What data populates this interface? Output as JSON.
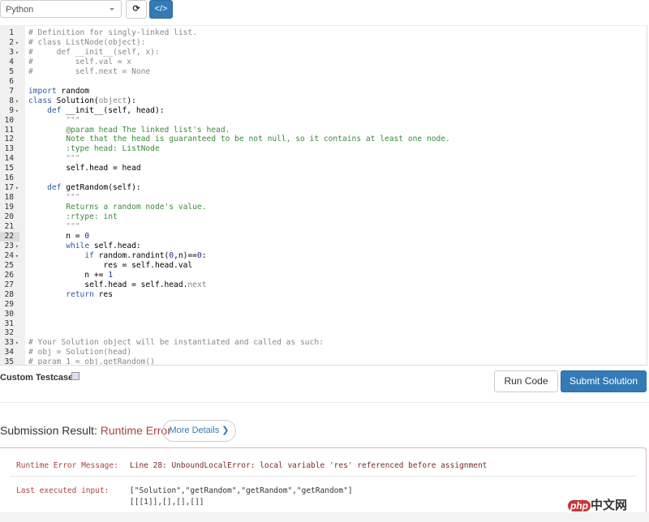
{
  "toolbar": {
    "language": "Python",
    "refresh_icon": "⟳",
    "code_icon": "</>"
  },
  "editor": {
    "active_line": 22,
    "lines": [
      [
        [
          "# Definition for singly-linked list.",
          "c"
        ]
      ],
      [
        [
          "# class ListNode(object):",
          "c"
        ]
      ],
      [
        [
          "#     def __init__(self, x):",
          "c"
        ]
      ],
      [
        [
          "#         self.val = x",
          "c"
        ]
      ],
      [
        [
          "#         self.next = None",
          "c"
        ]
      ],
      [],
      [
        [
          "import",
          "k"
        ],
        [
          " random",
          ""
        ]
      ],
      [
        [
          "class",
          "k"
        ],
        [
          " Solution(",
          ""
        ],
        [
          "object",
          "c"
        ],
        [
          "):",
          ""
        ]
      ],
      [
        [
          "    ",
          ""
        ],
        [
          "def",
          "k"
        ],
        [
          " __init__(self, head):",
          ""
        ]
      ],
      [
        [
          "        \"\"\"",
          "p"
        ]
      ],
      [
        [
          "        @param head The linked list's head.",
          "s"
        ]
      ],
      [
        [
          "        Note that the head is guaranteed to be not null, so it contains at least one node.",
          "s"
        ]
      ],
      [
        [
          "        :type head: ListNode",
          "s"
        ]
      ],
      [
        [
          "        \"\"\"",
          "p"
        ]
      ],
      [
        [
          "        self.head = head",
          ""
        ]
      ],
      [],
      [
        [
          "    ",
          ""
        ],
        [
          "def",
          "k"
        ],
        [
          " getRandom(self):",
          ""
        ]
      ],
      [
        [
          "        \"\"\"",
          "p"
        ]
      ],
      [
        [
          "        Returns a random node's value.",
          "s"
        ]
      ],
      [
        [
          "        :rtype: int",
          "s"
        ]
      ],
      [
        [
          "        \"\"\"",
          "p"
        ]
      ],
      [
        [
          "        n = ",
          ""
        ],
        [
          "0",
          "n"
        ]
      ],
      [
        [
          "        ",
          ""
        ],
        [
          "while",
          "k"
        ],
        [
          " self.head:",
          ""
        ]
      ],
      [
        [
          "            ",
          ""
        ],
        [
          "if",
          "k"
        ],
        [
          " random.randint(",
          ""
        ],
        [
          "0",
          "n"
        ],
        [
          ",n)==",
          ""
        ],
        [
          "0",
          "n"
        ],
        [
          ":",
          ""
        ]
      ],
      [
        [
          "                res = self.head.val",
          ""
        ]
      ],
      [
        [
          "            n += ",
          ""
        ],
        [
          "1",
          "n"
        ]
      ],
      [
        [
          "            self.head = self.head.",
          ""
        ],
        [
          "next",
          "c"
        ]
      ],
      [
        [
          "        ",
          ""
        ],
        [
          "return",
          "k"
        ],
        [
          " res",
          ""
        ]
      ],
      [],
      [],
      [],
      [],
      [
        [
          "# Your Solution object will be instantiated and called as such:",
          "c"
        ]
      ],
      [
        [
          "# obj = Solution(head)",
          "c"
        ]
      ],
      [
        [
          "# param_1 = obj.getRandom()",
          "c"
        ]
      ]
    ],
    "fold_lines": [
      2,
      3,
      8,
      9,
      17,
      23,
      24,
      33
    ]
  },
  "custom_testcase_label": "Custom Testcase",
  "run_code": "Run Code",
  "submit": "Submit Solution",
  "result": {
    "label": "Submission Result: ",
    "status": "Runtime Error",
    "more_details": "More Details ❯",
    "error_label": "Runtime Error Message:",
    "error_msg": "Line 28: UnboundLocalError: local variable 'res' referenced before assignment",
    "input_label": "Last executed input:",
    "input_line1": "[\"Solution\",\"getRandom\",\"getRandom\",\"getRandom\"]",
    "input_line2": "[[[1]],[],[],[]]"
  },
  "watermark": {
    "php": "php",
    "text": "中文网"
  }
}
